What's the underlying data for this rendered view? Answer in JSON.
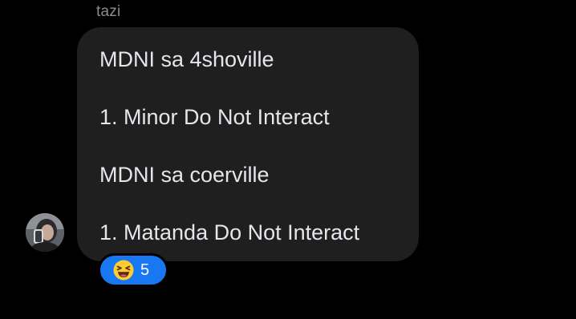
{
  "message": {
    "sender_name": "tazi",
    "lines": [
      "MDNI sa 4shoville",
      "1. Minor Do Not Interact",
      "MDNI sa coerville",
      "1. Matanda Do Not Interact"
    ]
  },
  "reaction": {
    "emoji_icon": "laughing-squint-emoji-icon",
    "count": "5",
    "pill_color": "#1877f2"
  },
  "colors": {
    "background": "#000000",
    "bubble": "#1f1f1f",
    "text": "#e4e6eb",
    "sender_name": "#8a8d91"
  }
}
